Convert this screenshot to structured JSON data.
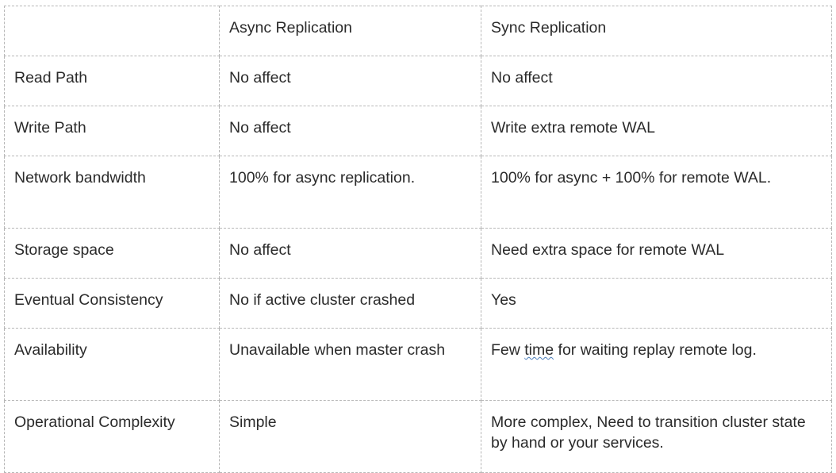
{
  "document": {
    "type": "comparison-table",
    "columns": [
      {
        "key": "attribute",
        "header": ""
      },
      {
        "key": "async",
        "header": "Async Replication"
      },
      {
        "key": "sync",
        "header": "Sync Replication"
      }
    ],
    "rows": [
      {
        "attribute": "Read Path",
        "async": "No affect",
        "sync": "No affect",
        "tall": false
      },
      {
        "attribute": "Write Path",
        "async": "No affect",
        "sync": "Write extra remote WAL",
        "tall": false
      },
      {
        "attribute": "Network bandwidth",
        "async": "100% for async replication.",
        "sync": "100% for async + 100% for remote WAL.",
        "tall": true
      },
      {
        "attribute": "Storage space",
        "async": "No affect",
        "sync": "Need extra space for remote WAL",
        "tall": false
      },
      {
        "attribute": "Eventual Consistency",
        "async": "No if active cluster crashed",
        "sync": "Yes",
        "tall": false
      },
      {
        "attribute": "Availability",
        "async": "Unavailable when master crash",
        "sync_prefix": "Few ",
        "sync_misspelled": "time",
        "sync_suffix": " for waiting replay remote log.",
        "sync": "Few time for waiting replay remote log.",
        "tall": true
      },
      {
        "attribute": "Operational Complexity",
        "async": "Simple",
        "sync": "More complex, Need to transition cluster state by hand or your services.",
        "tall": true
      }
    ]
  },
  "style": {
    "border_color": "#b7b7b7",
    "text_color": "#2b2b2b",
    "background": "#ffffff",
    "spellcheck_underline_color": "#4a7ebb"
  }
}
